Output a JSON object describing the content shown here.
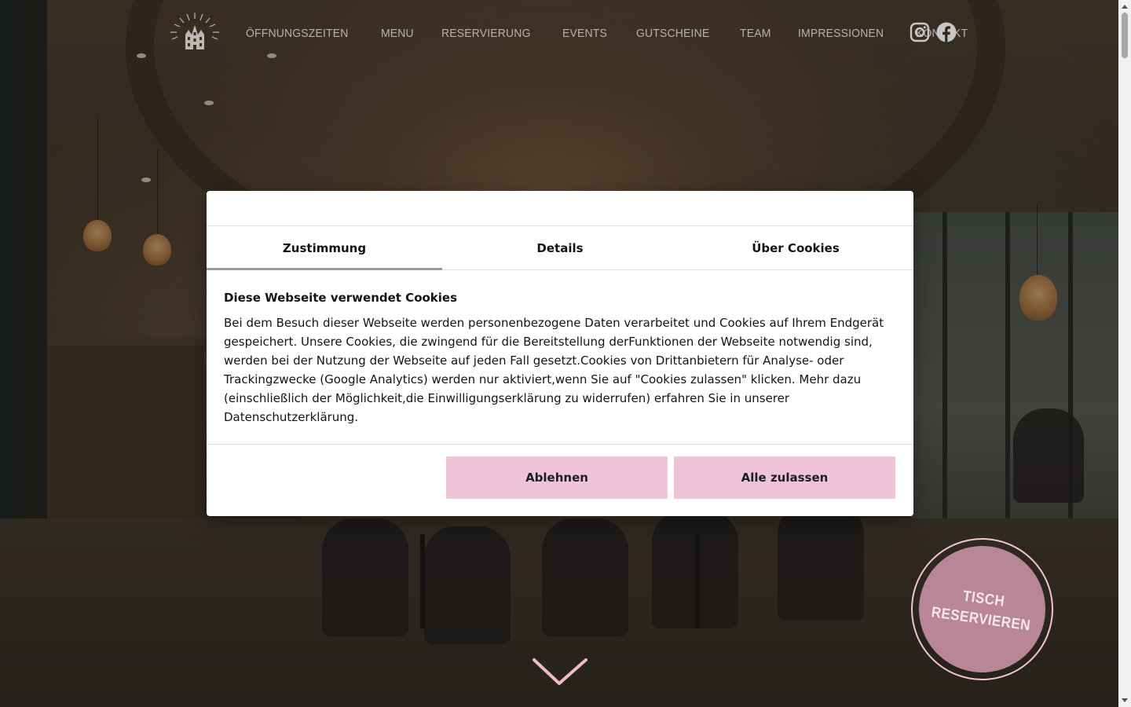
{
  "header": {
    "logo_alt": "",
    "nav": [
      {
        "label": "ÖFFNUNGSZEITEN"
      },
      {
        "label": "MENU"
      },
      {
        "label": "RESERVIERUNG"
      },
      {
        "label": "EVENTS"
      },
      {
        "label": "GUTSCHEINE"
      },
      {
        "label": "TEAM"
      },
      {
        "label": "IMPRESSIONEN"
      },
      {
        "label": "KONTAKT"
      }
    ],
    "social": [
      "instagram-icon",
      "facebook-icon"
    ]
  },
  "cookie_modal": {
    "tabs": [
      {
        "label": "Zustimmung",
        "active": true
      },
      {
        "label": "Details",
        "active": false
      },
      {
        "label": "Über Cookies",
        "active": false
      }
    ],
    "heading": "Diese Webseite verwendet Cookies",
    "body": "Bei dem Besuch dieser Webseite werden personenbezogene Daten verarbeitet und Cookies auf Ihrem Endgerät gespeichert. Unsere Cookies, die zwingend für die Bereitstellung derFunktionen der Webseite notwendig sind, werden bei der Nutzung der Webseite auf jeden Fall gesetzt.Cookies von Drittanbietern für Analyse- oder Trackingzwecke (Google Analytics) werden nur aktiviert,wenn Sie auf \"Cookies zulassen\" klicken. Mehr dazu (einschließlich der Möglichkeit,die Einwilligungserklärung zu widerrufen) erfahren Sie in unserer Datenschutzerklärung.",
    "decline_label": "Ablehnen",
    "accept_label": "Alle zulassen",
    "button_color": "#efc4d9"
  },
  "reserve_badge": {
    "line1": "TISCH",
    "line2": "RESERVIEREN",
    "color": "#b98599"
  },
  "scroll_hint": {
    "icon": "chevron-down-icon",
    "color": "#f2b8cc"
  }
}
